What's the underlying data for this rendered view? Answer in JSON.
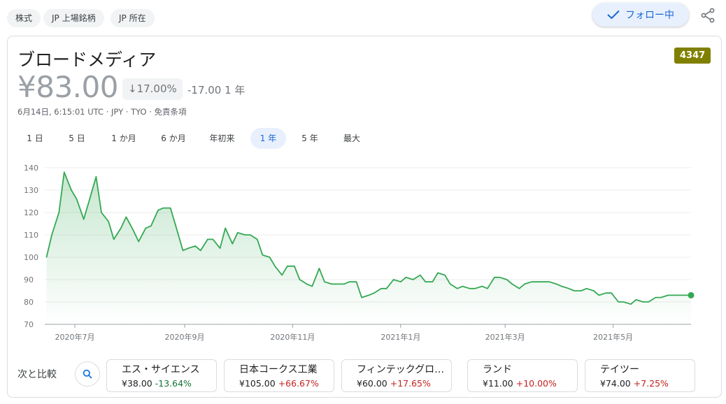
{
  "chips": [
    "株式",
    "JP 上場銘柄",
    "JP 所在"
  ],
  "follow_label": "フォロー中",
  "stock": {
    "name": "ブロードメディア",
    "ticker": "4347",
    "price": "¥83.00",
    "change_pct": "17.00%",
    "change_abs": "-17.00 1 年",
    "meta": "6月14日, 6:15:01 UTC · JPY · TYO · 免責条項"
  },
  "ranges": [
    "1 日",
    "5 日",
    "1 か月",
    "6 か月",
    "年初来",
    "1 年",
    "5 年",
    "最大"
  ],
  "active_range": "1 年",
  "colors": {
    "line": "#34a853",
    "accent": "#1967d2",
    "ticker_bg": "#808000",
    "negative": "#137333",
    "positive": "#c5221f"
  },
  "chart_data": {
    "type": "area",
    "ylim": [
      70,
      140
    ],
    "y_ticks": [
      70,
      80,
      90,
      100,
      110,
      120,
      130,
      140
    ],
    "grid": true,
    "x_tick_labels": [
      {
        "date": "2020-07-01",
        "label": "2020年7月"
      },
      {
        "date": "2020-09-01",
        "label": "2020年9月"
      },
      {
        "date": "2020-11-01",
        "label": "2020年11月"
      },
      {
        "date": "2021-01-01",
        "label": "2021年1月"
      },
      {
        "date": "2021-03-01",
        "label": "2021年3月"
      },
      {
        "date": "2021-05-01",
        "label": "2021年5月"
      }
    ],
    "x_range": [
      "2020-06-14",
      "2021-06-14"
    ],
    "series": [
      {
        "x": [
          "2020-06-15",
          "2020-06-18",
          "2020-06-22",
          "2020-06-25",
          "2020-06-29",
          "2020-07-02",
          "2020-07-06",
          "2020-07-09",
          "2020-07-13",
          "2020-07-16",
          "2020-07-20",
          "2020-07-23",
          "2020-07-27",
          "2020-07-30",
          "2020-08-03",
          "2020-08-06",
          "2020-08-10",
          "2020-08-13",
          "2020-08-17",
          "2020-08-20",
          "2020-08-24",
          "2020-08-27",
          "2020-08-31",
          "2020-09-03",
          "2020-09-07",
          "2020-09-10",
          "2020-09-14",
          "2020-09-17",
          "2020-09-21",
          "2020-09-24",
          "2020-09-28",
          "2020-10-01",
          "2020-10-05",
          "2020-10-08",
          "2020-10-12",
          "2020-10-15",
          "2020-10-19",
          "2020-10-22",
          "2020-10-26",
          "2020-10-29",
          "2020-11-02",
          "2020-11-05",
          "2020-11-09",
          "2020-11-12",
          "2020-11-16",
          "2020-11-19",
          "2020-11-23",
          "2020-11-26",
          "2020-11-30",
          "2020-12-03",
          "2020-12-07",
          "2020-12-10",
          "2020-12-14",
          "2020-12-17",
          "2020-12-21",
          "2020-12-24",
          "2020-12-28",
          "2021-01-01",
          "2021-01-04",
          "2021-01-08",
          "2021-01-12",
          "2021-01-15",
          "2021-01-19",
          "2021-01-22",
          "2021-01-26",
          "2021-01-29",
          "2021-02-02",
          "2021-02-05",
          "2021-02-09",
          "2021-02-12",
          "2021-02-16",
          "2021-02-19",
          "2021-02-23",
          "2021-02-26",
          "2021-03-02",
          "2021-03-05",
          "2021-03-09",
          "2021-03-12",
          "2021-03-16",
          "2021-03-19",
          "2021-03-23",
          "2021-03-26",
          "2021-03-30",
          "2021-04-02",
          "2021-04-06",
          "2021-04-09",
          "2021-04-13",
          "2021-04-16",
          "2021-04-20",
          "2021-04-23",
          "2021-04-27",
          "2021-04-30",
          "2021-05-04",
          "2021-05-07",
          "2021-05-11",
          "2021-05-14",
          "2021-05-18",
          "2021-05-21",
          "2021-05-25",
          "2021-05-28",
          "2021-06-01",
          "2021-06-04",
          "2021-06-08",
          "2021-06-11",
          "2021-06-14"
        ],
        "y": [
          100,
          110,
          120,
          138,
          130,
          126,
          117,
          125,
          136,
          120,
          116,
          108,
          113,
          118,
          112,
          107,
          113,
          114,
          121,
          122,
          122,
          114,
          103,
          104,
          105,
          103,
          108,
          108,
          104,
          113,
          106,
          111,
          110,
          110,
          108,
          101,
          100,
          96,
          92,
          96,
          96,
          90,
          88,
          87,
          95,
          89,
          88,
          88,
          88,
          89,
          89,
          82,
          83,
          84,
          86,
          86,
          90,
          89,
          91,
          90,
          92,
          89,
          89,
          93,
          92,
          88,
          86,
          87,
          86,
          86,
          87,
          86,
          91,
          91,
          90,
          88,
          86,
          88,
          89,
          89,
          89,
          89,
          88,
          87,
          86,
          85,
          85,
          86,
          85,
          83,
          84,
          84,
          80,
          80,
          79,
          81,
          80,
          80,
          82,
          82,
          83,
          83,
          83,
          83,
          83
        ]
      }
    ]
  },
  "compare": {
    "label": "次と比較",
    "items": [
      {
        "name": "エス・サイエンス",
        "price": "¥38.00",
        "change": "-13.64%",
        "dir": "neg"
      },
      {
        "name": "日本コークス工業",
        "price": "¥105.00",
        "change": "+66.67%",
        "dir": "pos"
      },
      {
        "name": "フィンテックグロー…",
        "price": "¥60.00",
        "change": "+17.65%",
        "dir": "pos"
      },
      {
        "name": "ランド",
        "price": "¥11.00",
        "change": "+10.00%",
        "dir": "pos"
      },
      {
        "name": "テイツー",
        "price": "¥74.00",
        "change": "+7.25%",
        "dir": "pos"
      }
    ]
  }
}
